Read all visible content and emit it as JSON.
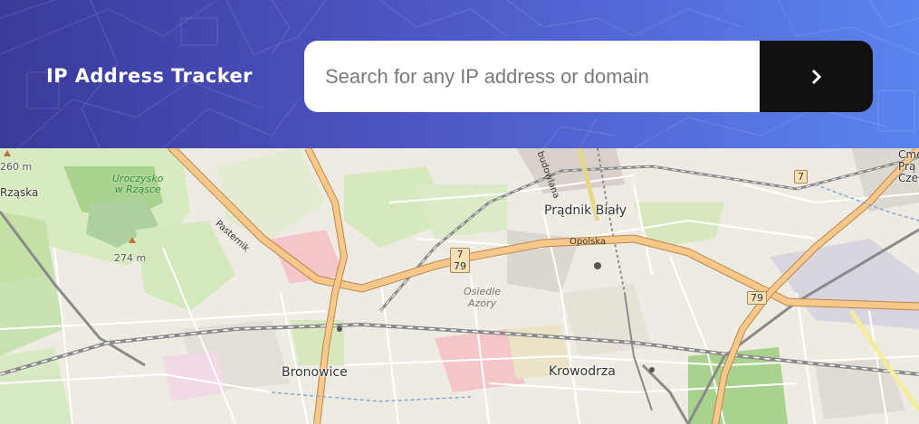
{
  "header": {
    "title": "IP Address Tracker",
    "search": {
      "placeholder": "Search for any IP address or domain",
      "value": ""
    },
    "submit_icon": "chevron-right-icon",
    "gradient": [
      "#3b3a9a",
      "#5b84ee"
    ]
  },
  "map": {
    "places": {
      "pradnik_bialy": "Prądnik Biały",
      "bronowice": "Bronowice",
      "krowodrza": "Krowodrza",
      "rzaska": "Rząska",
      "cme_fragment": "Cme",
      "pra_fragment": "Prą",
      "cze_fragment": "Czeł"
    },
    "parks": {
      "uroczysko_line1": "Uroczysko",
      "uroczysko_line2": "w Rząsce"
    },
    "districts": {
      "osiedle_line1": "Osiedle",
      "osiedle_line2": "Azory"
    },
    "streets": {
      "opolska": "Opolska",
      "pasternik": "Pasternik",
      "budowlana": "budowlana"
    },
    "elevations": {
      "e260": "260 m",
      "e274": "274 m"
    },
    "road_shields": {
      "r7_a": "7",
      "r79_a": "79",
      "r7_b": "7",
      "r79_b": "79"
    }
  }
}
